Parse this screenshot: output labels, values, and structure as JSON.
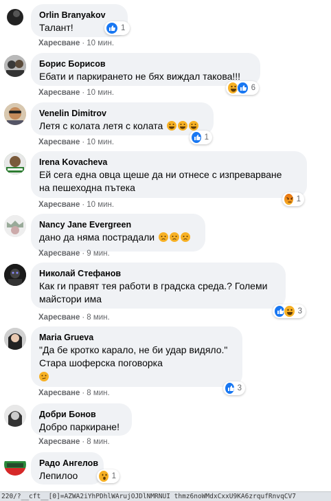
{
  "like_label": "Харесване",
  "separator": "·",
  "comments": [
    {
      "author": "Orlin Branyakov",
      "text": "Талант!",
      "time": "10 мин.",
      "reactions": {
        "types": [
          "like"
        ],
        "count": "1"
      }
    },
    {
      "author": "Борис Борисов",
      "text": "Ебати и паркирането не бях виждал такова!!!",
      "time": "10 мин.",
      "reactions": {
        "types": [
          "haha",
          "like"
        ],
        "count": "6"
      }
    },
    {
      "author": "Venelin Dimitrov",
      "text": "Летя с колата летя с колата",
      "emoji": [
        "haha",
        "haha",
        "haha"
      ],
      "time": "10 мин.",
      "reactions": {
        "types": [
          "like"
        ],
        "count": "1"
      }
    },
    {
      "author": "Irena Kovacheva",
      "text": "Ей сега една овца щеше да ни отнесе с изпреварване\nна пешеходна пътека",
      "time": "10 мин.",
      "reactions": {
        "types": [
          "angry"
        ],
        "count": "1"
      }
    },
    {
      "author": "Nancy Jane Evergreen",
      "text": "дано да няма пострадали",
      "emoji": [
        "sad",
        "sad",
        "sad"
      ],
      "time": "9 мин.",
      "reactions": null
    },
    {
      "author": "Николай Стефанов",
      "text": "Как ги правят тея работи в градска среда.? Големи\nмайстори има",
      "time": "8 мин.",
      "reactions": {
        "types": [
          "like",
          "haha"
        ],
        "count": "3"
      }
    },
    {
      "author": "Maria Grueva",
      "text": "\"Да бе кротко карало, не би удар видяло.\"\nСтара шоферска поговорка",
      "emoji_line": "confused",
      "time": "8 мин.",
      "reactions": {
        "types": [
          "like"
        ],
        "count": "3"
      }
    },
    {
      "author": "Добри Бонов",
      "text": "Добро паркиране!",
      "time": "8 мин.",
      "reactions": null
    },
    {
      "author": "Радо Ангелов",
      "text": "Лепилоо",
      "time": "8 мин.",
      "reactions": {
        "types": [
          "wow"
        ],
        "count": "1"
      }
    }
  ],
  "status_url": "220/?__cft__[0]=AZWA2iYhPDhlWArujOJDlNMRNUI thmz6noWMdxCxxU9KA6zrqufRnvqCV7",
  "colors": {
    "like": "#1877f2",
    "emoji": "#f7b125",
    "bubble": "#f0f2f5",
    "meta": "#65676b"
  }
}
